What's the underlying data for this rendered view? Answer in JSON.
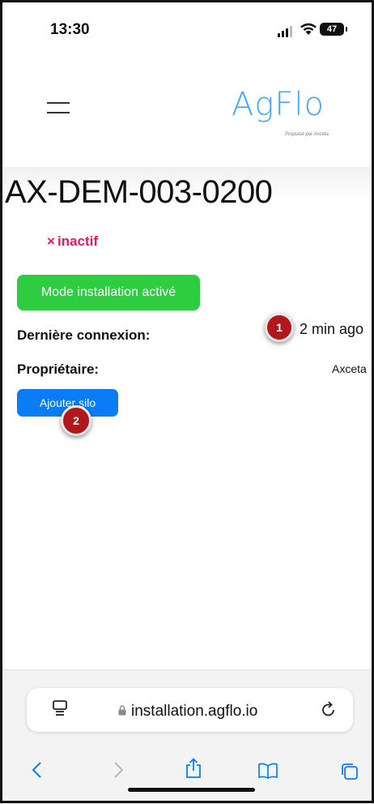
{
  "status_bar": {
    "time": "13:30",
    "battery": "47"
  },
  "header": {
    "logo_text": "AgFlo",
    "logo_tagline": "Propulsé par Axceta"
  },
  "device": {
    "title": "AX-DEM-003-0200",
    "status_symbol": "×",
    "status_text": "inactif",
    "install_mode_button": "Mode installation activé",
    "last_connection_label": "Dernière connexion:",
    "last_connection_value": "2 min ago",
    "owner_label": "Propriétaire:",
    "owner_value": "Axceta",
    "add_silo_button": "Ajouter silo"
  },
  "markers": [
    "1",
    "2"
  ],
  "browser": {
    "url": "installation.agflo.io"
  },
  "colors": {
    "accent_blue": "#0a7cf5",
    "install_green": "#2ecc40",
    "status_red": "#e5195b",
    "logo_blue": "#3fa9f5",
    "marker_red": "#b0181b"
  },
  "icons": [
    "tabs-overview-icon",
    "lock-icon",
    "reload-icon",
    "back-icon",
    "forward-icon",
    "share-icon",
    "bookmarks-icon",
    "tabs-icon"
  ]
}
